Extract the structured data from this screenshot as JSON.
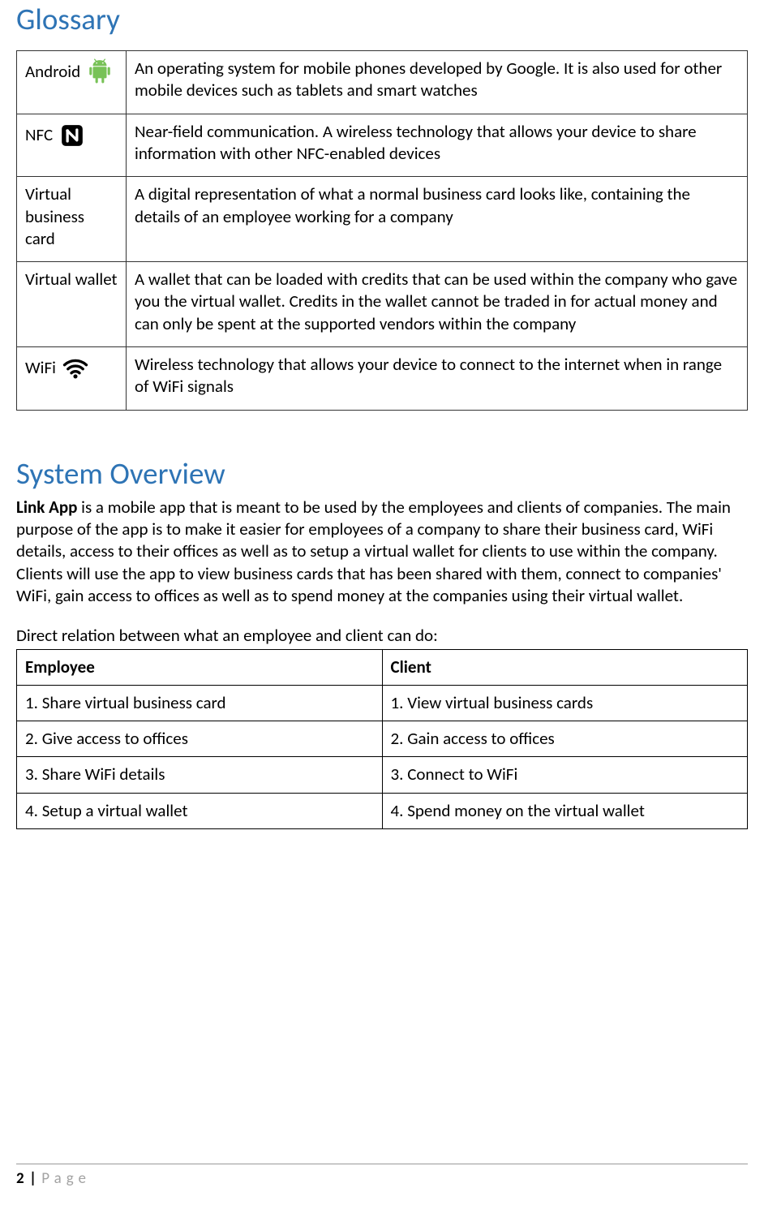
{
  "headings": {
    "glossary": "Glossary",
    "system_overview": "System Overview"
  },
  "glossary": [
    {
      "term": "Android",
      "icon": "android",
      "definition": "An operating system for mobile phones developed by Google. It is also used for other mobile devices such as tablets and smart watches"
    },
    {
      "term": "NFC",
      "icon": "nfc",
      "definition": "Near-field communication. A wireless technology that allows your device to share information with other NFC-enabled devices"
    },
    {
      "term": "Virtual business card",
      "icon": "",
      "definition": "A digital representation of what a normal business card looks like, containing the details of an employee working for a company"
    },
    {
      "term": "Virtual wallet",
      "icon": "",
      "definition": "A wallet that can be loaded with credits that can be used within the company who gave you the virtual wallet. Credits in the wallet cannot be traded in for actual money and can only be spent at the supported vendors within the company"
    },
    {
      "term": "WiFi",
      "icon": "wifi",
      "definition": "Wireless technology that allows your device to connect to the internet when in range of WiFi signals"
    }
  ],
  "overview": {
    "bold_lead": "Link App",
    "paragraph_rest": " is a mobile app that is meant to be used by the employees and clients of companies. The main purpose of the app is to make it easier for employees of a company to share their business card, WiFi details, access to their offices as well as to setup a virtual wallet for clients to use within the company. Clients will use the app to view business cards that has been shared with them, connect to companies' WiFi, gain access to offices as well as to spend money at the companies using their virtual wallet."
  },
  "relation": {
    "intro": "Direct relation between what an employee and client can do:",
    "headers": {
      "employee": "Employee",
      "client": "Client"
    },
    "rows": [
      {
        "employee": "1. Share virtual business card",
        "client": "1. View virtual business cards"
      },
      {
        "employee": "2. Give access to offices",
        "client": "2. Gain access to offices"
      },
      {
        "employee": "3. Share WiFi details",
        "client": "3. Connect to WiFi"
      },
      {
        "employee": "4. Setup a virtual wallet",
        "client": "4. Spend money on the virtual wallet"
      }
    ]
  },
  "footer": {
    "page_number": "2",
    "separator": "|",
    "label": "Page"
  }
}
